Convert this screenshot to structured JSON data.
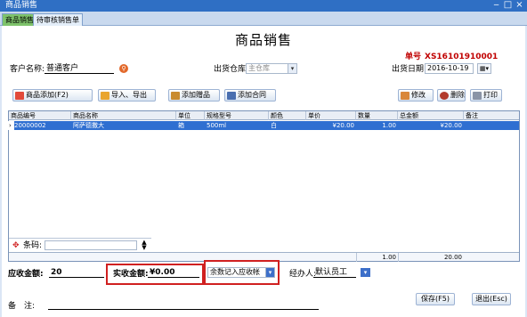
{
  "window": {
    "title": "商品销售",
    "controls": [
      "‒",
      "□",
      "×"
    ]
  },
  "tabs": [
    {
      "label": "商品销售"
    },
    {
      "label": "待审核销售单"
    }
  ],
  "form": {
    "heading": "商品销售",
    "order_label": "单号",
    "order_no": "XS16101910001",
    "customer_label": "客户名称:",
    "customer_value": "普通客户",
    "warehouse_label": "出货仓库:",
    "warehouse_value": "主仓库",
    "date_label": "出货日期:",
    "date_value": "2016-10-19"
  },
  "toolbar": {
    "add_goods": "商品添加(F2)",
    "import_export": "导入、导出",
    "add_gift": "添加赠品",
    "add_contract": "添加合同",
    "edit": "修改",
    "delete": "删除",
    "print": "打印"
  },
  "table": {
    "columns": [
      "商品编号",
      "商品名称",
      "单位",
      "规格型号",
      "颜色",
      "单价",
      "数量",
      "总金额",
      "备注"
    ],
    "rows": [
      {
        "marker": "›",
        "code": "20000002",
        "name": "阿萨德撒大",
        "unit": "箱",
        "spec": "500ml",
        "color": "白",
        "price": "¥20.00",
        "qty": "1.00",
        "total": "¥20.00",
        "note": ""
      }
    ],
    "barcode_label": "条码:",
    "footer_qty": "1.00",
    "footer_total": "20.00"
  },
  "summary": {
    "receivable_label": "应收金额:",
    "receivable_value": "20",
    "actual_label": "实收金额:",
    "actual_value": "¥0.00",
    "balance_select": "余数记入应收帐",
    "handler_label": "经办人:",
    "handler_value": "默认员工",
    "remark_label": "备　注:",
    "remark_value": ""
  },
  "actions": {
    "save": "保存(F5)",
    "exit": "退出(Esc)"
  },
  "colors": {
    "titlebar": "#2f6fc4",
    "active_tab": "#7ec36b",
    "selected_row": "#2f6fd1",
    "order_no": "#c00000",
    "highlight_box": "#d02020"
  }
}
